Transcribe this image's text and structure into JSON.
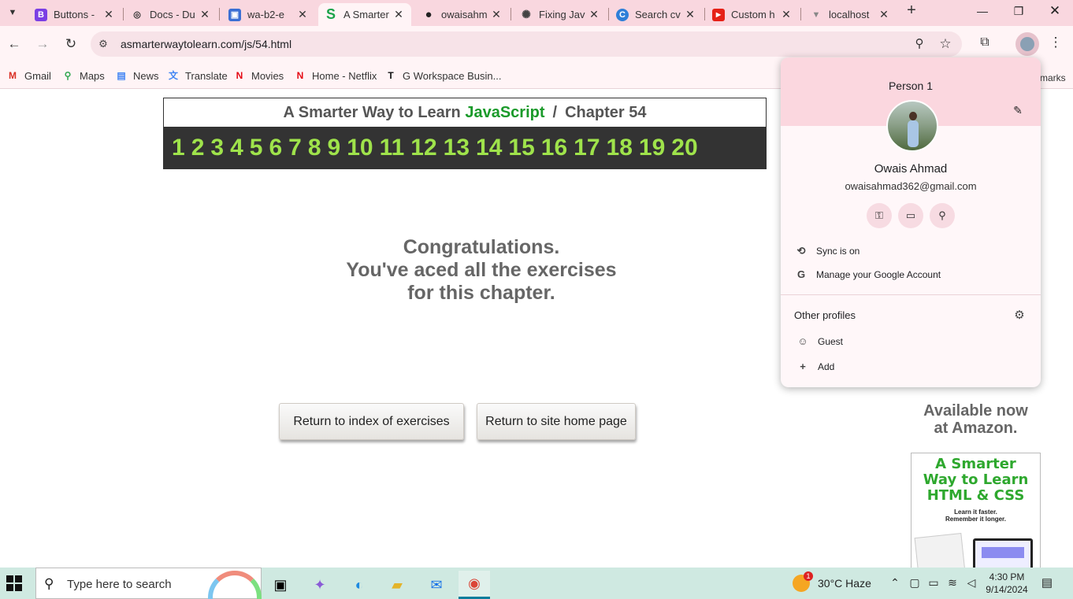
{
  "browser": {
    "tabs": [
      {
        "title": "Buttons - ",
        "favicon": "B",
        "color": "#7b3fe4"
      },
      {
        "title": "Docs - Du",
        "favicon": "◎",
        "color": "#333333"
      },
      {
        "title": "wa-b2-e",
        "favicon": "▣",
        "color": "#3b6fd4"
      },
      {
        "title": "A Smarter",
        "favicon": "S",
        "color": "#1aa34a"
      },
      {
        "title": "owaisahm",
        "favicon": "●",
        "color": "#222222"
      },
      {
        "title": "Fixing Jav",
        "favicon": "✺",
        "color": "#444444"
      },
      {
        "title": "Search cv",
        "favicon": "C",
        "color": "#2f7fd8"
      },
      {
        "title": "Custom h",
        "favicon": "▶",
        "color": "#e62117"
      },
      {
        "title": "localhost",
        "favicon": "▼",
        "color": "#888888"
      }
    ],
    "url": "asmarterwaytolearn.com/js/54.html",
    "bookmarks": [
      "Gmail",
      "Maps",
      "News",
      "Translate",
      "Movies",
      "Home - Netflix",
      "G Workspace Busin..."
    ],
    "bookmarks_more": "marks"
  },
  "page": {
    "header_prefix": "A Smarter Way to Learn ",
    "header_js": "JavaScript",
    "header_slash": "/",
    "header_chapter": "Chapter 54",
    "numbers": [
      "1",
      "2",
      "3",
      "4",
      "5",
      "6",
      "7",
      "8",
      "9",
      "10",
      "11",
      "12",
      "13",
      "14",
      "15",
      "16",
      "17",
      "18",
      "19",
      "20"
    ],
    "congrats_line1": "Congratulations.",
    "congrats_line2": "You've aced all the exercises",
    "congrats_line3": "for this chapter.",
    "btn_index": "Return to index of exercises",
    "btn_home": "Return to site home page",
    "amazon_line1": "Available now",
    "amazon_line2": "at Amazon.",
    "book_title_1": "A Smarter",
    "book_title_2": "Way to Learn",
    "book_title_3": "HTML & CSS",
    "book_sub_1": "Learn it faster.",
    "book_sub_2": "Remember it longer."
  },
  "profile": {
    "person_label": "Person 1",
    "name": "Owais Ahmad",
    "email": "owaisahmad362@gmail.com",
    "sync": "Sync is on",
    "manage": "Manage your Google Account",
    "other_profiles": "Other profiles",
    "guest": "Guest",
    "add": "Add"
  },
  "taskbar": {
    "search_placeholder": "Type here to search",
    "weather": "30°C  Haze",
    "weather_badge": "1",
    "time": "4:30 PM",
    "date": "9/14/2024"
  },
  "colors": {
    "tabstrip": "#f9d7df",
    "js_green": "#1a9a2a",
    "number_green": "#9fe34b",
    "taskbar": "#cfe9e1"
  }
}
